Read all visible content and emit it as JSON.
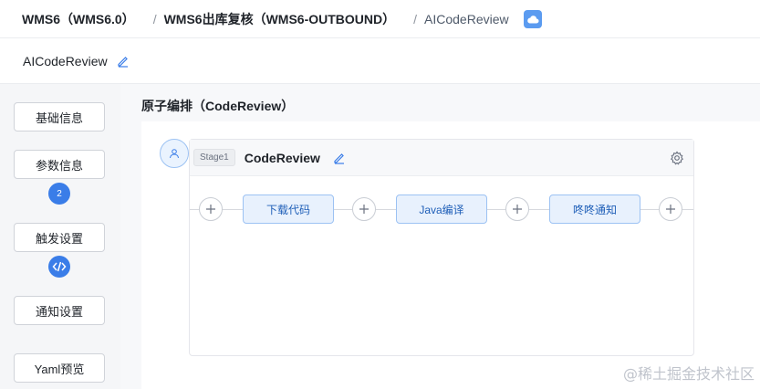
{
  "breadcrumb": {
    "items": [
      "WMS6（WMS6.0）",
      "WMS6出库复核（WMS6-OUTBOUND）",
      "AICodeReview"
    ],
    "separator": "/"
  },
  "pipeline": {
    "name": "AICodeReview"
  },
  "sidebar": {
    "items": [
      {
        "label": "基础信息"
      },
      {
        "label": "参数信息",
        "badge": "2"
      },
      {
        "label": "触发设置",
        "badge_icon": "code-icon"
      },
      {
        "label": "通知设置"
      },
      {
        "label": "Yaml预览"
      }
    ]
  },
  "main": {
    "section_title": "原子编排（CodeReview）",
    "stage": {
      "tag": "Stage1",
      "name": "CodeReview",
      "steps": [
        {
          "label": "下载代码"
        },
        {
          "label": "Java编译"
        },
        {
          "label": "咚咚通知"
        }
      ]
    }
  },
  "watermark": "@稀土掘金技术社区",
  "colors": {
    "accent": "#3a7de8",
    "step_bg": "#e8f1fd",
    "step_border": "#9cc2f3"
  }
}
